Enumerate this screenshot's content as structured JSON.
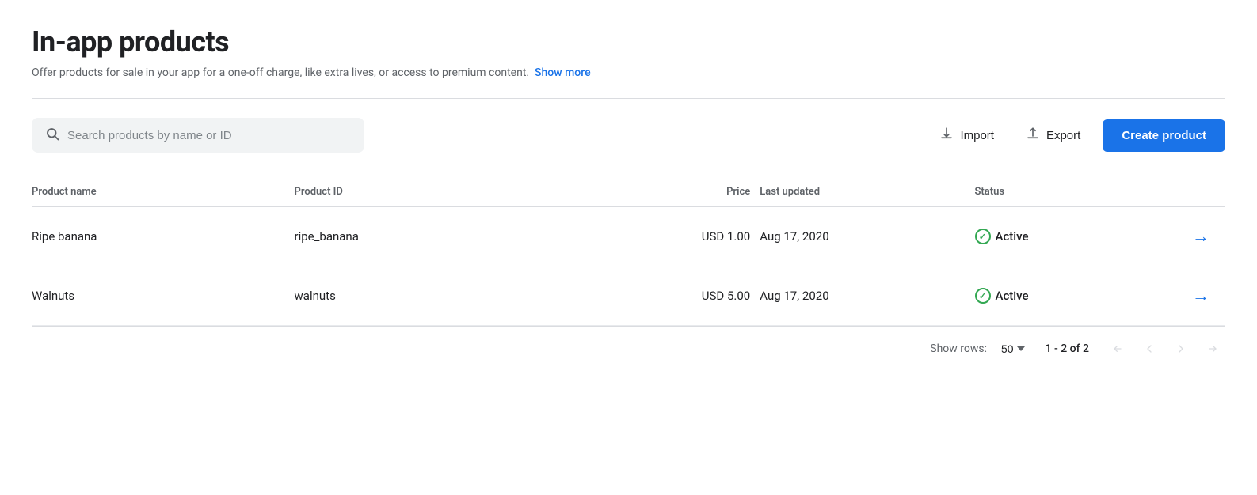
{
  "page": {
    "title": "In-app products",
    "subtitle": "Offer products for sale in your app for a one-off charge, like extra lives, or access to premium content.",
    "show_more_label": "Show more"
  },
  "toolbar": {
    "search_placeholder": "Search products by name or ID",
    "import_label": "Import",
    "export_label": "Export",
    "create_label": "Create product"
  },
  "table": {
    "columns": [
      {
        "id": "name",
        "label": "Product name"
      },
      {
        "id": "id",
        "label": "Product ID"
      },
      {
        "id": "price",
        "label": "Price"
      },
      {
        "id": "updated",
        "label": "Last updated"
      },
      {
        "id": "status",
        "label": "Status"
      }
    ],
    "rows": [
      {
        "name": "Ripe banana",
        "product_id": "ripe_banana",
        "price": "USD 1.00",
        "updated": "Aug 17, 2020",
        "status": "Active"
      },
      {
        "name": "Walnuts",
        "product_id": "walnuts",
        "price": "USD 5.00",
        "updated": "Aug 17, 2020",
        "status": "Active"
      }
    ]
  },
  "pagination": {
    "show_rows_label": "Show rows:",
    "rows_per_page": "50",
    "range": "1 - 2 of 2"
  },
  "colors": {
    "blue": "#1a73e8",
    "green": "#34a853",
    "text_primary": "#202124",
    "text_secondary": "#5f6368"
  }
}
